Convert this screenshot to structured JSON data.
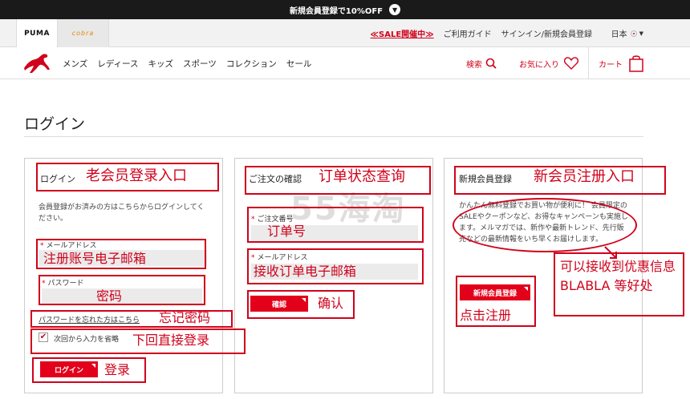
{
  "promo": {
    "text": "新規会員登録で10%OFF"
  },
  "utility": {
    "brand_puma": "PUMA",
    "brand_cobra": "cobra",
    "sale": "≪SALE開催中≫",
    "guide": "ご利用ガイド",
    "signin": "サインイン/新規会員登録",
    "lang": "日本"
  },
  "nav": {
    "items": [
      "メンズ",
      "レディース",
      "キッズ",
      "スポーツ",
      "コレクション",
      "セール"
    ],
    "search": "検索",
    "favorites": "お気に入り",
    "cart": "カート"
  },
  "page": {
    "title": "ログイン"
  },
  "watermark": "55海淘",
  "login_panel": {
    "heading": "ログイン",
    "desc": "会員登録がお済みの方はこちらからログインしてください。",
    "email_label": "メールアドレス",
    "password_label": "パスワード",
    "forgot": "パスワードを忘れた方はこちら",
    "remember": "次回から入力を省略",
    "button": "ログイン"
  },
  "order_panel": {
    "heading": "ご注文の確認",
    "order_label": "ご注文番号",
    "email_label": "メールアドレス",
    "button": "確認"
  },
  "register_panel": {
    "heading": "新規会員登録",
    "desc": "かんたん無料登録でお買い物が便利に！ 会員限定のSALEやクーポンなど、お得なキャンペーンも実施します。メルマガでは、新作や最新トレンド、先行販売などの最新情報をいち早くお届けします。",
    "button": "新規会員登録"
  },
  "annotations": {
    "old_member": "老会员登录入口",
    "email_account": "注册账号电子邮箱",
    "password": "密码",
    "forgot": "忘记密码",
    "remember": "下回直接登录",
    "login": "登录",
    "order_status": "订单状态查询",
    "order_number": "订单号",
    "order_email": "接收订单电子邮箱",
    "confirm": "确认",
    "new_member": "新会员注册入口",
    "benefits": "可以接收到优惠信息 BLABLA 等好处",
    "click_register": "点击注册"
  },
  "colors": {
    "accent": "#d0021b",
    "button": "#e3001b",
    "promo_bg": "#1a1a1a"
  }
}
